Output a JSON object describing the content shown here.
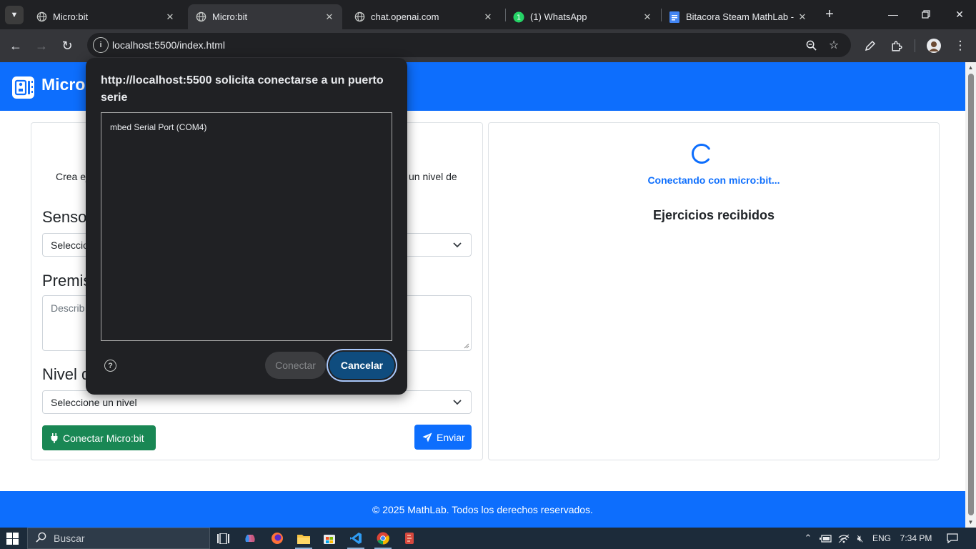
{
  "tabs": [
    {
      "title": "Micro:bit",
      "icon": "globe-icon"
    },
    {
      "title": "Micro:bit",
      "icon": "globe-icon"
    },
    {
      "title": "chat.openai.com",
      "icon": "globe-icon"
    },
    {
      "title": "(1) WhatsApp",
      "icon": "whatsapp-icon"
    },
    {
      "title": "Bitacora Steam MathLab - D",
      "icon": "google-docs-icon"
    }
  ],
  "address_bar": {
    "url": "localhost:5500/index.html"
  },
  "page": {
    "brand": "Micro:",
    "left_card": {
      "intro_left": "Crea ej",
      "intro_right": "un nivel de",
      "sensor_heading": "Sensor",
      "sensor_select_value": "Seleccio",
      "premise_heading": "Premis",
      "premise_placeholder": "Describ",
      "level_heading": "Nivel d",
      "level_select_value": "Seleccione un nivel",
      "connect_button": "Conectar Micro:bit",
      "send_button": "Enviar"
    },
    "right_card": {
      "status": "Conectando con micro:bit...",
      "heading": "Ejercicios recibidos"
    },
    "footer": "© 2025 MathLab. Todos los derechos reservados."
  },
  "dialog": {
    "title": "http://localhost:5500 solicita conectarse a un puerto serie",
    "ports": [
      "mbed Serial Port (COM4)"
    ],
    "connect_label": "Conectar",
    "cancel_label": "Cancelar",
    "help_symbol": "?"
  },
  "taskbar": {
    "search_placeholder": "Buscar",
    "language": "ENG",
    "time": "7:34 PM"
  },
  "colors": {
    "primary": "#0d6efd",
    "success": "#198754",
    "chrome_dark": "#202124",
    "chrome_toolbar": "#35363a"
  }
}
